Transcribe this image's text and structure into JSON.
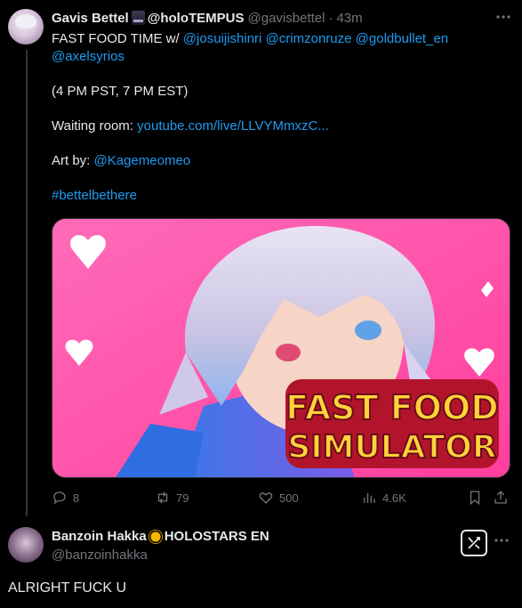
{
  "tweet1": {
    "author_name": "Gavis Bettel",
    "author_suffix": "@holoTEMPUS",
    "handle": "@gavisbettel",
    "separator": "·",
    "time": "43m",
    "line1_prefix": "FAST FOOD TIME w/ ",
    "mentions": [
      "@josuijishinri",
      "@crimzonruze",
      "@goldbullet_en",
      "@axelsyrios"
    ],
    "schedule": "(4 PM PST, 7 PM EST)",
    "waiting_label": "Waiting room: ",
    "waiting_link": "youtube.com/live/LLVYMmxzC...",
    "art_label": "Art by: ",
    "art_link": "@Kagemeomeo",
    "hashtag": "#bettelbethere",
    "media": {
      "title_line1": "FAST FOOD",
      "title_line2": "SIMULATOR"
    },
    "actions": {
      "replies": "8",
      "reposts": "79",
      "likes": "500",
      "views": "4.6K"
    }
  },
  "tweet2": {
    "author_name": "Banzoin Hakka",
    "author_suffix": "HOLOSTARS EN",
    "handle": "@banzoinhakka",
    "text": "ALRIGHT FUCK U"
  },
  "colors": {
    "background": "#000000",
    "text": "#e7e9ea",
    "secondary": "#71767b",
    "link": "#1d9bf0",
    "media_pink": "#ff5fae"
  }
}
